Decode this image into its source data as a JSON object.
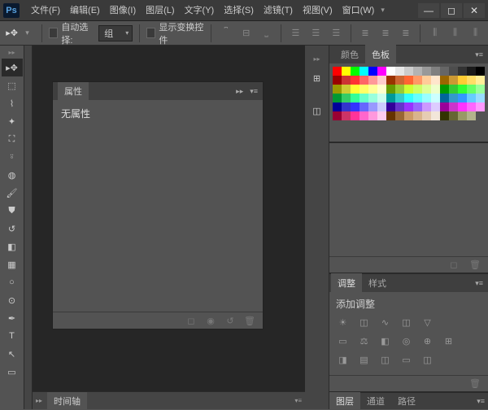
{
  "app": {
    "logo": "Ps"
  },
  "menu": [
    "文件(F)",
    "编辑(E)",
    "图像(I)",
    "图层(L)",
    "文字(Y)",
    "选择(S)",
    "滤镜(T)",
    "视图(V)",
    "窗口(W)"
  ],
  "options": {
    "autoselect_label": "自动选择:",
    "group": "组",
    "show_transform": "显示变换控件"
  },
  "props_panel": {
    "tab": "属性",
    "empty": "无属性"
  },
  "timeline": {
    "tab": "时间轴"
  },
  "color_tabs": {
    "color": "颜色",
    "swatches": "色板"
  },
  "swatches": [
    [
      "#ff0000",
      "#ffff00",
      "#00ff00",
      "#00ffff",
      "#0000ff",
      "#ff00ff",
      "#ffffff",
      "#e6e6e6",
      "#cccccc",
      "#b3b3b3",
      "#999999",
      "#808080",
      "#666666",
      "#4d4d4d",
      "#333333",
      "#1a1a1a",
      "#000000"
    ],
    [
      "#990000",
      "#cc3333",
      "#ff3333",
      "#ff6666",
      "#ff9999",
      "#ffcccc",
      "#993300",
      "#cc6633",
      "#ff6633",
      "#ff9966",
      "#ffcc99",
      "#ffe6cc",
      "#996600",
      "#cc9933",
      "#ffcc33",
      "#ffdd66",
      "#ffee99"
    ],
    [
      "#999900",
      "#cccc33",
      "#ffff33",
      "#ffff66",
      "#ffff99",
      "#ffffcc",
      "#669900",
      "#99cc33",
      "#ccff33",
      "#ccff66",
      "#ddff99",
      "#eeffcc",
      "#009900",
      "#33cc33",
      "#33ff33",
      "#66ff66",
      "#99ff99"
    ],
    [
      "#009933",
      "#33cc66",
      "#33ff99",
      "#66ffcc",
      "#99ffdd",
      "#ccffee",
      "#009999",
      "#33cccc",
      "#33ffff",
      "#66ffff",
      "#99ffff",
      "#ccffff",
      "#006699",
      "#3399cc",
      "#3399ff",
      "#66ccff",
      "#99ddff"
    ],
    [
      "#000099",
      "#3333cc",
      "#3333ff",
      "#6666ff",
      "#9999ff",
      "#ccccff",
      "#330099",
      "#6633cc",
      "#9933ff",
      "#9966ff",
      "#cc99ff",
      "#ddccff",
      "#990099",
      "#cc33cc",
      "#ff33ff",
      "#ff66ff",
      "#ff99ff"
    ],
    [
      "#990033",
      "#cc3366",
      "#ff3399",
      "#ff66cc",
      "#ff99dd",
      "#ffccee",
      "#663300",
      "#996633",
      "#cc9966",
      "#d9b38c",
      "#e6ccb3",
      "#f2e6d9",
      "#333300",
      "#666633",
      "#999966",
      "#b3b38c"
    ]
  ],
  "adjustments": {
    "tab1": "调整",
    "tab2": "样式",
    "title": "添加调整"
  },
  "layer_tabs": {
    "layers": "图层",
    "channels": "通道",
    "paths": "路径"
  }
}
